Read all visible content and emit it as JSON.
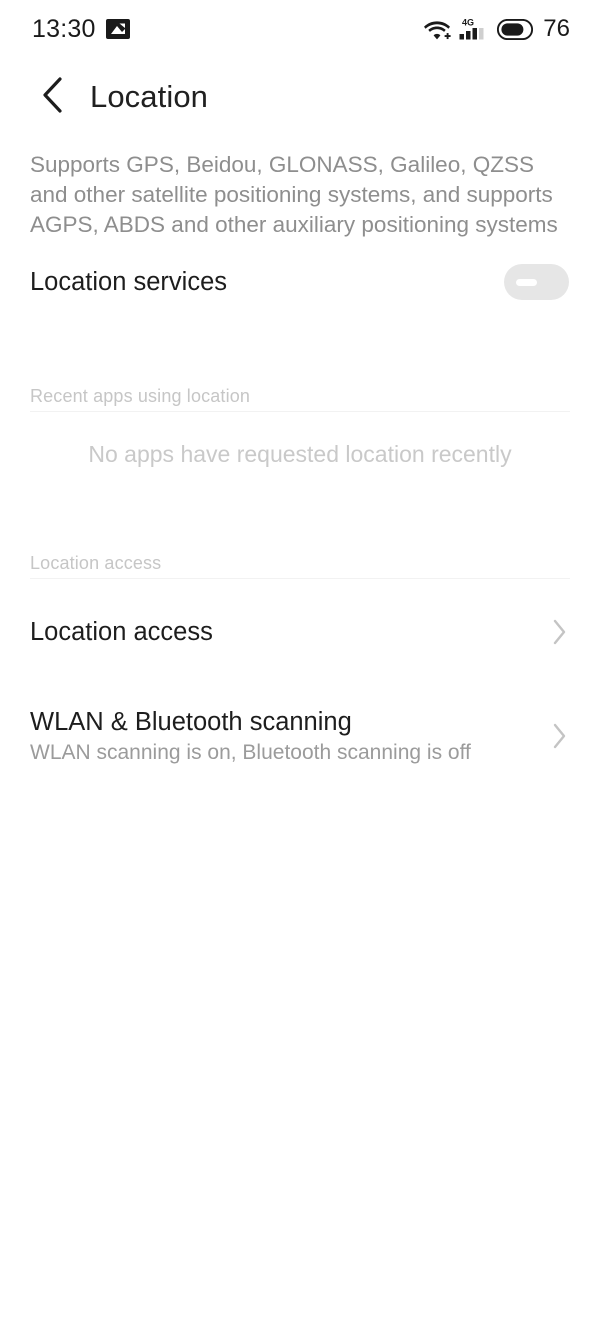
{
  "status_bar": {
    "time": "13:30",
    "screenshot_icon": "image-icon",
    "wifi_icon": "wifi-plus-icon",
    "signal_icon": "signal-4g-icon",
    "signal_network_label": "4G",
    "battery_icon": "battery-icon",
    "battery_percent": "76"
  },
  "header": {
    "back_icon": "chevron-left-icon",
    "title": "Location"
  },
  "description": "Supports GPS, Beidou, GLONASS, Galileo, QZSS and other satellite positioning systems, and supports AGPS, ABDS and other auxiliary positioning systems",
  "location_services": {
    "label": "Location services",
    "toggle_state": "off",
    "toggle_name": "location-services-toggle"
  },
  "recent_apps": {
    "section_label": "Recent apps using location",
    "empty_message": "No apps have requested location recently"
  },
  "location_access": {
    "section_label": "Location access",
    "rows": [
      {
        "title": "Location access",
        "subtitle": "",
        "chevron": "chevron-right-icon"
      },
      {
        "title": "WLAN & Bluetooth scanning",
        "subtitle": "WLAN scanning is on, Bluetooth scanning is off",
        "chevron": "chevron-right-icon"
      }
    ]
  },
  "colors": {
    "background": "#ffffff",
    "primary_text": "#1d1d1d",
    "secondary_text": "#8e8e8e",
    "muted_text": "#c6c6c6",
    "divider": "#f2f2f2",
    "toggle_off": "#e6e6e6"
  }
}
